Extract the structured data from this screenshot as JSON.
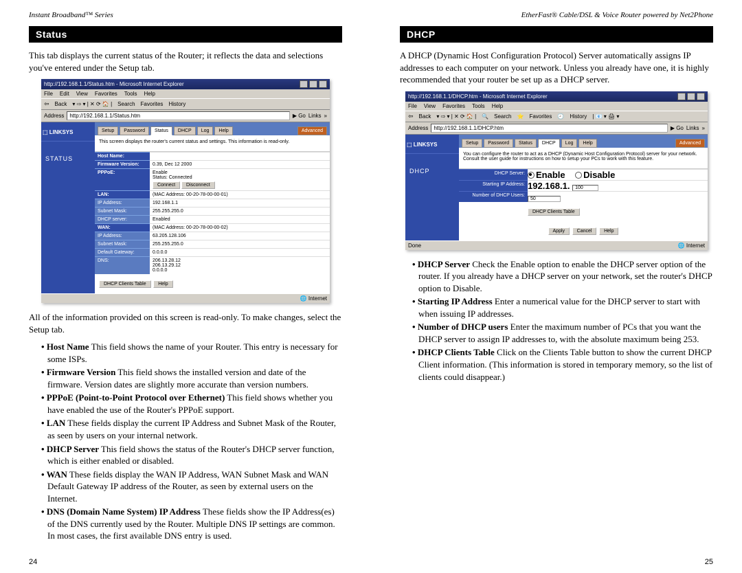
{
  "left": {
    "running_head": "Instant Broadband™ Series",
    "section_title": "Status",
    "intro": "This tab displays the current status of the Router; it reflects the data and selections you've entered under the Setup tab.",
    "after_shot": "All of the information provided on this screen is read-only.  To make changes, select the Setup tab.",
    "bullets": [
      {
        "b": "Host Name",
        "t": "  This field shows the name of your Router. This entry is necessary for some ISPs."
      },
      {
        "b": "Firmware Version",
        "t": "  This field shows the installed version and date of the firmware.  Version dates are slightly more accurate than version numbers."
      },
      {
        "b": "PPPoE (Point-to-Point Protocol over Ethernet)",
        "t": " This field shows whether you have enabled the use of the Router's PPPoE support."
      },
      {
        "b": "LAN",
        "t": "  These fields display the current IP Address and Subnet Mask of the Router, as seen by users on your internal network."
      },
      {
        "b": "DHCP Server",
        "t": "  This field shows the status of the Router's DHCP server function, which is either enabled or disabled."
      },
      {
        "b": "WAN",
        "t": "  These fields display the WAN IP Address, WAN Subnet Mask and WAN Default Gateway IP address of the Router, as seen by external users on the Internet."
      },
      {
        "b": "DNS (Domain Name System) IP Address",
        "t": "  These fields show the IP Address(es) of the DNS currently used by the Router. Multiple DNS IP settings are common. In most cases, the first available DNS entry is used."
      }
    ],
    "page_number": "24",
    "shot": {
      "title": "http://192.168.1.1/Status.htm - Microsoft Internet Explorer",
      "menus": [
        "File",
        "Edit",
        "View",
        "Favorites",
        "Tools",
        "Help"
      ],
      "toolbar": {
        "back": "Back",
        "search": "Search",
        "favorites": "Favorites",
        "history": "History"
      },
      "address_label": "Address",
      "address": "http://192.168.1.1/Status.htm",
      "go": "Go",
      "links": "Links",
      "logo": "LINKSYS",
      "side_title": "STATUS",
      "tabs": [
        "Setup",
        "Password",
        "Status",
        "DHCP",
        "Log",
        "Help"
      ],
      "advanced": "Advanced",
      "note": "This screen displays the router's current status and settings. This information is read-only.",
      "rows": {
        "host_name_lbl": "Host Name:",
        "host_name": "",
        "firmware_lbl": "Firmware Version:",
        "firmware": "0.39, Dec 12 2000",
        "pppoe_lbl": "PPPoE:",
        "pppoe_enable": "Enable",
        "pppoe_status": "Status: Connected",
        "connect": "Connect",
        "disconnect": "Disconnect",
        "lan_lbl": "LAN:",
        "lan_mac": "(MAC Address: 00-20-78-00-00-01)",
        "ip_lbl": "IP Address:",
        "ip": "192.168.1.1",
        "subnet_lbl": "Subnet Mask:",
        "subnet": "255.255.255.0",
        "dhcp_lbl": "DHCP server:",
        "dhcp": "Enabled",
        "wan_lbl": "WAN:",
        "wan_mac": "(MAC Address: 00-20-78-00-00-02)",
        "wip_lbl": "IP Address:",
        "wip": "63.205.128.106",
        "wsubnet_lbl": "Subnet Mask:",
        "wsubnet": "255.255.255.0",
        "gw_lbl": "Default Gateway:",
        "gw": "0.0.0.0",
        "dns_lbl": "DNS:",
        "dns1": "206.13.28.12",
        "dns2": "206.13.29.12",
        "dns3": "0.0.0.0",
        "clients": "DHCP Clients Table",
        "help": "Help"
      },
      "status_left": "",
      "status_right": "Internet"
    }
  },
  "right": {
    "running_head": "EtherFast® Cable/DSL & Voice Router powered by Net2Phone",
    "section_title": "DHCP",
    "intro": "A DHCP (Dynamic Host Configuration Protocol) Server automatically assigns IP addresses to each computer on your network. Unless you already have one, it is highly recommended that your router be set up as a DHCP server.",
    "bullets": [
      {
        "b": "DHCP Server",
        "t": "  Check the Enable option to enable the DHCP server option of the router. If you already have a DHCP server on your network, set the router's DHCP option to Disable."
      },
      {
        "b": "Starting IP Address",
        "t": "  Enter a numerical value for the DHCP server to start with when issuing IP addresses."
      },
      {
        "b": "Number of DHCP users",
        "t": "  Enter the maximum number of PCs that you want the DHCP server to assign IP addresses to, with the absolute maximum being 253."
      },
      {
        "b": "DHCP Clients Table",
        "t": "  Click on the Clients Table button to show the current DHCP Client information. (This information is stored in temporary memory, so the list of clients could disappear.)"
      }
    ],
    "page_number": "25",
    "shot": {
      "title": "http://192.168.1.1/DHCP.htm - Microsoft Internet Explorer",
      "menus": [
        "File",
        "View",
        "Favorites",
        "Tools",
        "Help"
      ],
      "toolbar": {
        "back": "Back",
        "search": "Search",
        "favorites": "Favorites",
        "history": "History"
      },
      "address_label": "Address",
      "address": "http://192.168.1.1/DHCP.htm",
      "go": "Go",
      "links": "Links",
      "logo": "LINKSYS",
      "side_title": "DHCP",
      "tabs": [
        "Setup",
        "Password",
        "Status",
        "DHCP",
        "Log",
        "Help"
      ],
      "advanced": "Advanced",
      "note": "You can configure the router to act as a DHCP (Dynamic Host Configuration Protocol) server for your network. Consult the user guide for instructions on how to setup your PCs to work with this feature.",
      "rows": {
        "server_lbl": "DHCP Server:",
        "enable": "Enable",
        "disable": "Disable",
        "start_lbl": "Starting IP Address:",
        "start_prefix": "192.168.1.",
        "start_val": "100",
        "num_lbl": "Number of DHCP Users:",
        "num_val": "50",
        "clients": "DHCP Clients Table",
        "apply": "Apply",
        "cancel": "Cancel",
        "help": "Help"
      },
      "status_left": "Done",
      "status_right": "Internet"
    }
  }
}
